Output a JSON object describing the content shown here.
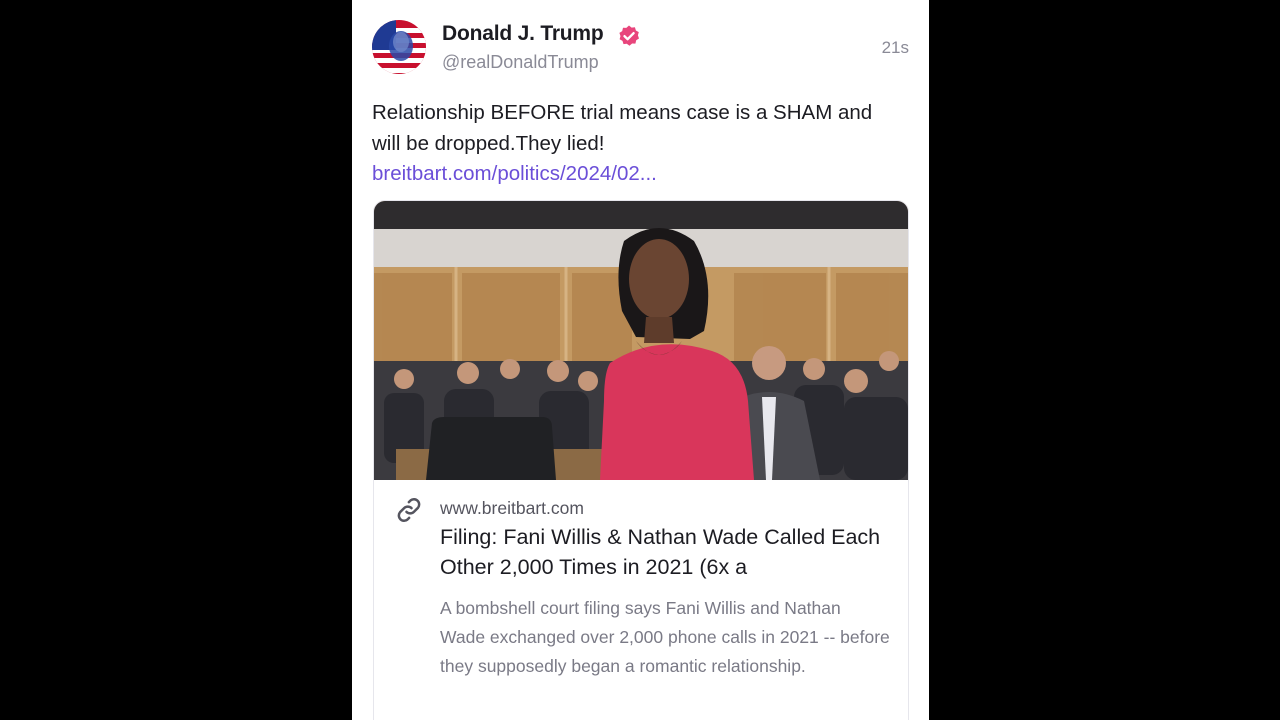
{
  "post": {
    "author": {
      "display_name": "Donald J. Trump",
      "handle": "@realDonaldTrump",
      "verified": true,
      "avatar_icon": "flag-portrait-avatar"
    },
    "timestamp": "21s",
    "text_before_link": "Relationship BEFORE trial means case is a SHAM and will be dropped.They lied! ",
    "link_text": "breitbart.com/politics/2024/02..."
  },
  "link_card": {
    "image_alt": "courtroom-photo",
    "link_icon": "link-icon",
    "domain": "www.breitbart.com",
    "title": "Filing: Fani Willis & Nathan Wade Called Each Other 2,000 Times in 2021 (6x a",
    "description": "A bombshell court filing says Fani Willis and Nathan Wade exchanged over 2,000 phone calls in 2021 -- before they supposedly began a romantic relationship."
  },
  "colors": {
    "background": "#000000",
    "card_background": "#ffffff",
    "link": "#6b4fd8",
    "verified_badge": "#e8457c",
    "text_primary": "#1c1c22",
    "text_secondary": "#8a8a96"
  }
}
